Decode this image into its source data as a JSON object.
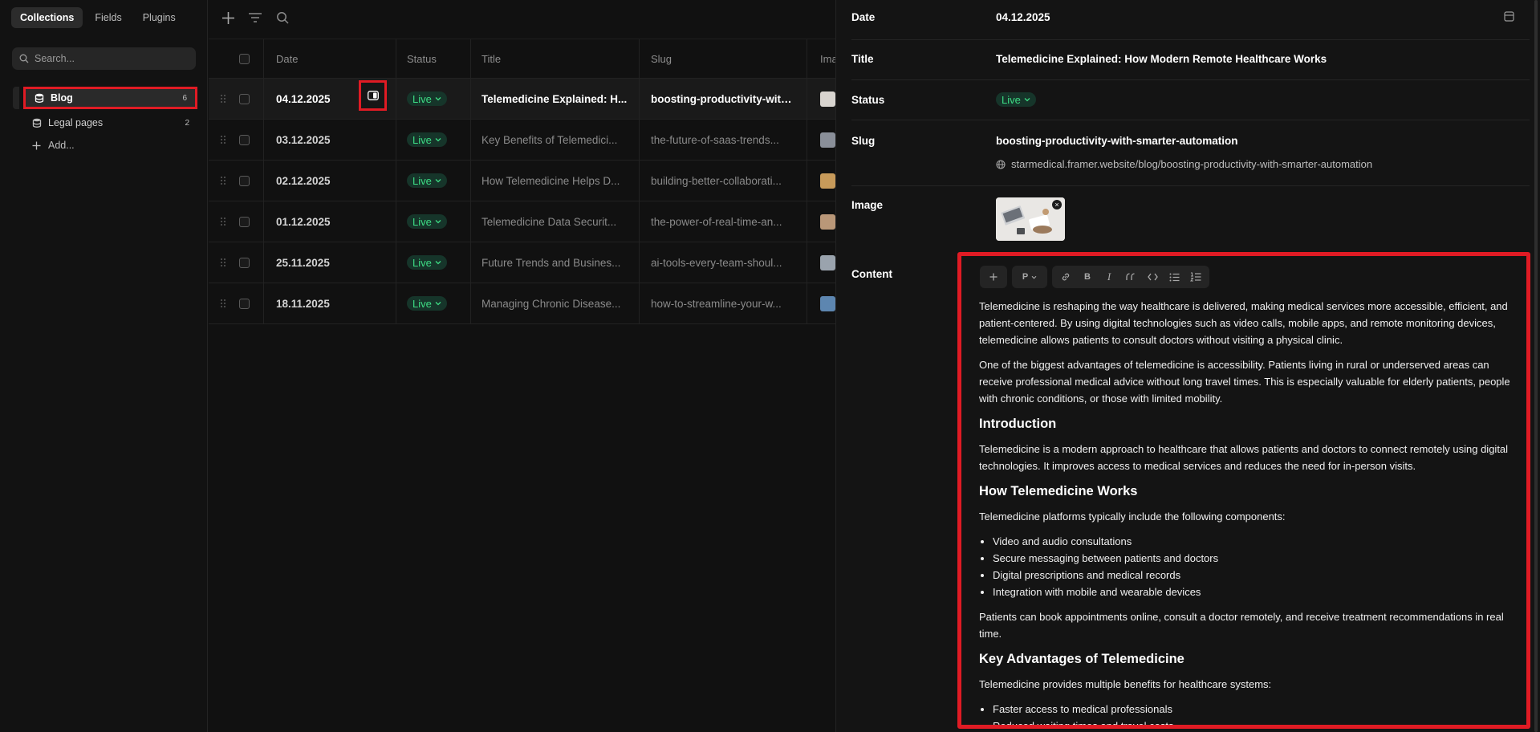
{
  "sidebar": {
    "tabs": [
      "Collections",
      "Fields",
      "Plugins"
    ],
    "search_placeholder": "Search...",
    "collections": [
      {
        "label": "Blog",
        "count": "6"
      },
      {
        "label": "Legal pages",
        "count": "2"
      }
    ],
    "add_label": "Add..."
  },
  "table": {
    "headers": {
      "date": "Date",
      "status": "Status",
      "title": "Title",
      "slug": "Slug",
      "image": "Ima"
    },
    "rows": [
      {
        "date": "04.12.2025",
        "status": "Live",
        "title": "Telemedicine Explained: H...",
        "slug": "boosting-productivity-with...",
        "thumb_color": "#d8d4cf"
      },
      {
        "date": "03.12.2025",
        "status": "Live",
        "title": "Key Benefits of Telemedici...",
        "slug": "the-future-of-saas-trends...",
        "thumb_color": "#8a8f99"
      },
      {
        "date": "02.12.2025",
        "status": "Live",
        "title": "How Telemedicine Helps D...",
        "slug": "building-better-collaborati...",
        "thumb_color": "#c79a5a"
      },
      {
        "date": "01.12.2025",
        "status": "Live",
        "title": "Telemedicine Data Securit...",
        "slug": "the-power-of-real-time-an...",
        "thumb_color": "#b99778"
      },
      {
        "date": "25.11.2025",
        "status": "Live",
        "title": "Future Trends and Busines...",
        "slug": "ai-tools-every-team-shoul...",
        "thumb_color": "#9aa3ad"
      },
      {
        "date": "18.11.2025",
        "status": "Live",
        "title": "Managing Chronic Disease...",
        "slug": "how-to-streamline-your-w...",
        "thumb_color": "#5d86b0"
      }
    ]
  },
  "detail": {
    "date_label": "Date",
    "date_value": "04.12.2025",
    "title_label": "Title",
    "title_value": "Telemedicine Explained: How Modern Remote Healthcare Works",
    "status_label": "Status",
    "status_value": "Live",
    "slug_label": "Slug",
    "slug_value": "boosting-productivity-with-smarter-automation",
    "url_value": "starmedical.framer.website/blog/boosting-productivity-with-smarter-automation",
    "image_label": "Image",
    "content_label": "Content"
  },
  "editor": {
    "block_type": "P",
    "paragraphs": [
      "Telemedicine is reshaping the way healthcare is delivered, making medical services more accessible, efficient, and patient-centered. By using digital technologies such as video calls, mobile apps, and remote monitoring devices, telemedicine allows patients to consult doctors without visiting a physical clinic.",
      "One of the biggest advantages of telemedicine is accessibility. Patients living in rural or underserved areas can receive professional medical advice without long travel times. This is especially valuable for elderly patients, people with chronic conditions, or those with limited mobility."
    ],
    "h_intro": "Introduction",
    "p_intro": "Telemedicine is a modern approach to healthcare that allows patients and doctors to connect remotely using digital technologies. It improves access to medical services and reduces the need for in-person visits.",
    "h_works": "How Telemedicine Works",
    "p_works": "Telemedicine platforms typically include the following components:",
    "works_list": [
      "Video and audio consultations",
      "Secure messaging between patients and doctors",
      "Digital prescriptions and medical records",
      "Integration with mobile and wearable devices"
    ],
    "p_patients": "Patients can book appointments online, consult a doctor remotely, and receive treatment recommendations in real time.",
    "h_adv": "Key Advantages of Telemedicine",
    "p_adv": "Telemedicine provides multiple benefits for healthcare systems:",
    "adv_list": [
      "Faster access to medical professionals",
      "Reduced waiting times and travel costs"
    ]
  },
  "colors": {
    "accent_red": "#e01b24",
    "live_green": "#3ddc84",
    "background": "#111111"
  }
}
